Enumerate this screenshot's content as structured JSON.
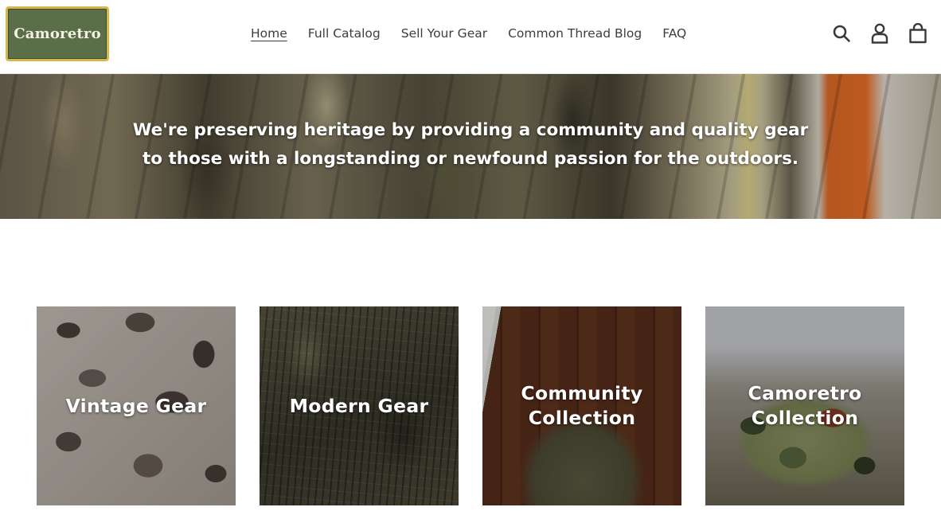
{
  "header": {
    "logo_text": "Camoretro",
    "nav": [
      {
        "label": "Home",
        "active": true
      },
      {
        "label": "Full Catalog",
        "active": false
      },
      {
        "label": "Sell Your Gear",
        "active": false
      },
      {
        "label": "Common Thread Blog",
        "active": false
      },
      {
        "label": "FAQ",
        "active": false
      }
    ],
    "icons": [
      "search-icon",
      "account-icon",
      "cart-icon"
    ]
  },
  "hero": {
    "line1": "We're preserving heritage by providing a community and quality gear",
    "line2": "to those with a longstanding or newfound passion for the outdoors."
  },
  "collections": [
    {
      "line1": "Vintage Gear",
      "line2": ""
    },
    {
      "line1": "Modern Gear",
      "line2": ""
    },
    {
      "line1": "Community",
      "line2": "Collection"
    },
    {
      "line1": "Camoretro",
      "line2": "Collection"
    }
  ],
  "colors": {
    "logo_bg": "#5a6e4a",
    "logo_border": "#d7b64a",
    "hero_accent_orange": "#ee6a1d"
  }
}
